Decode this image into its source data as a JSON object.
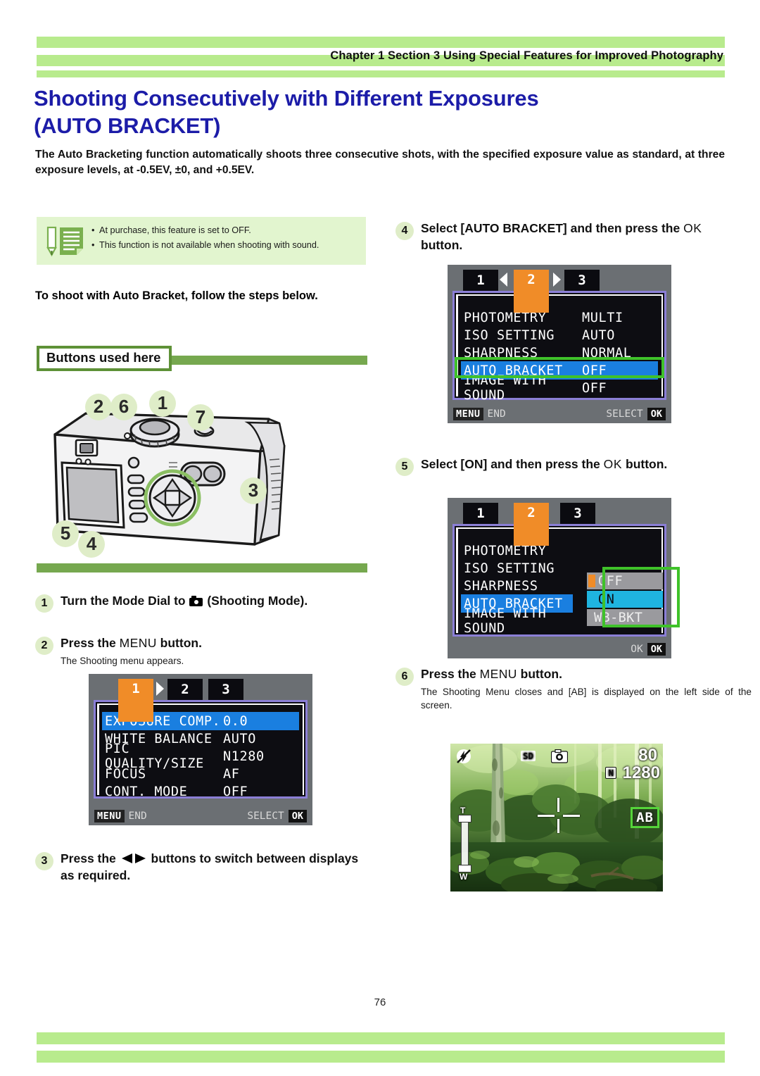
{
  "header": {
    "title": "Chapter 1 Section 3 Using Special Features for Improved Photography",
    "bar_color": "#b8eb8d"
  },
  "title": {
    "line1": "Shooting Consecutively with Different Exposures",
    "line2": "(AUTO BRACKET)",
    "color": "#1c1ca8"
  },
  "intro": "The Auto Bracketing function automatically shoots three consecutive shots, with the specified exposure value as standard, at three exposure levels, at -0.5EV, ±0,  and +0.5EV.",
  "note": {
    "icon": "memo-pencil-icon",
    "bullet1": "At purchase, this feature is set to OFF.",
    "bullet2": "This function is not available when shooting with sound.",
    "bg_color": "#e2f5cf"
  },
  "lead_in": "To shoot with Auto Bracket, follow the steps below.",
  "buttons_used": {
    "label": "Buttons used here",
    "border_color": "#5e9137",
    "bar_color": "#76a84f"
  },
  "camera_figure": {
    "name": "camera-back-illustration",
    "callouts": [
      "2",
      "6",
      "1",
      "7",
      "3",
      "5",
      "4"
    ]
  },
  "steps": [
    {
      "num": "1",
      "head_pre": "Turn the Mode Dial to ",
      "head_post": " (Shooting Mode).",
      "icon": "camera-mode-icon",
      "sub": ""
    },
    {
      "num": "2",
      "head_pre": "Press the ",
      "head_mid": "MENU",
      "head_post": " button.",
      "sub": "The Shooting menu appears."
    },
    {
      "num": "3",
      "head_pre": "Press the ",
      "head_post": " buttons to switch between displays as required.",
      "icon": "left-right-arrows-icon",
      "sub": ""
    },
    {
      "num": "4",
      "head_pre": "Select  [AUTO BRACKET] and then press the ",
      "head_mid": "OK",
      "head_post": " button.",
      "sub": ""
    },
    {
      "num": "5",
      "head_pre": "Select  [ON] and then press the ",
      "head_mid": "OK",
      "head_post": " button.",
      "sub": ""
    },
    {
      "num": "6",
      "head_pre": "Press the ",
      "head_mid": "MENU",
      "head_post": " button.",
      "sub": "The Shooting Menu closes and [AB] is displayed on the left side of the screen."
    }
  ],
  "lcd1": {
    "name": "shooting-menu-page-1",
    "tabs": [
      "1",
      "2",
      "3"
    ],
    "active_tab": "1",
    "rows": [
      {
        "label": "EXPOSURE COMP.",
        "value": "0.0",
        "selected": true
      },
      {
        "label": "WHITE BALANCE",
        "value": "AUTO",
        "selected": false
      },
      {
        "label": "PIC QUALITY/SIZE",
        "value": "N1280",
        "selected": false
      },
      {
        "label": "FOCUS",
        "value": "AF",
        "selected": false
      },
      {
        "label": "CONT. MODE",
        "value": "OFF",
        "selected": false
      }
    ],
    "footer_left_badge": "MENU",
    "footer_left_text": "END",
    "footer_right_text": "SELECT",
    "footer_right_badge": "OK"
  },
  "lcd2": {
    "name": "shooting-menu-page-2",
    "tabs": [
      "1",
      "2",
      "3"
    ],
    "active_tab": "2",
    "rows": [
      {
        "label": "PHOTOMETRY",
        "value": "MULTI",
        "selected": false
      },
      {
        "label": "ISO SETTING",
        "value": "AUTO",
        "selected": false
      },
      {
        "label": "SHARPNESS",
        "value": "NORMAL",
        "selected": false
      },
      {
        "label": "AUTO BRACKET",
        "value": "OFF",
        "selected": true
      },
      {
        "label": "IMAGE WITH SOUND",
        "value": "OFF",
        "selected": false
      }
    ],
    "highlight": "AUTO BRACKET",
    "highlight_color": "#3fc22a",
    "footer_left_badge": "MENU",
    "footer_left_text": "END",
    "footer_right_text": "SELECT",
    "footer_right_badge": "OK"
  },
  "lcd3": {
    "name": "auto-bracket-options",
    "tabs": [
      "1",
      "2",
      "3"
    ],
    "active_tab": "2",
    "rows": [
      {
        "label": "PHOTOMETRY",
        "value": "",
        "selected": false
      },
      {
        "label": "ISO SETTING",
        "value": "",
        "selected": false
      },
      {
        "label": "SHARPNESS",
        "value": "",
        "selected": false
      },
      {
        "label": "AUTO BRACKET",
        "value": "",
        "selected": true
      },
      {
        "label": "IMAGE WITH SOUND",
        "value": "",
        "selected": false
      }
    ],
    "options": [
      {
        "label": "OFF",
        "state": "unselected"
      },
      {
        "label": "ON",
        "state": "selected"
      },
      {
        "label": "WB-BKT",
        "state": "unselected"
      }
    ],
    "highlight_color": "#3fc22a",
    "footer_right_text": "OK",
    "footer_right_badge": "OK"
  },
  "liveview": {
    "name": "live-view-screen",
    "flash_icon": "flash-off-icon",
    "sd_badge": "SD",
    "camera_icon": "camera-icon",
    "shots_remaining": "80",
    "quality_badge": "N",
    "resolution": "1280",
    "ab_indicator": "AB",
    "zoom_bar_top": "T",
    "zoom_bar_bottom": "W"
  },
  "footer": {
    "page_number": "76",
    "bar_color": "#b8eb8d"
  }
}
